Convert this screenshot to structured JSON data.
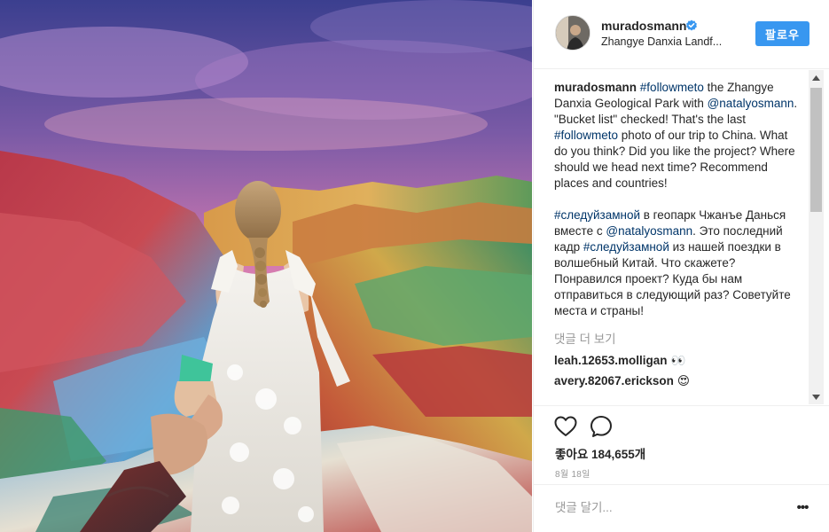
{
  "post": {
    "username": "muradosmann",
    "location": "Zhangye Danxia Landf...",
    "follow_label": "팔로우",
    "caption": {
      "username": "muradosmann",
      "en": [
        {
          "t": "#followmeto",
          "tag": true
        },
        {
          "t": " the Zhangye Danxia Geological Park with ",
          "tag": false
        },
        {
          "t": "@natalyosmann",
          "tag": true
        },
        {
          "t": ". \"Bucket list\" checked! That's the last ",
          "tag": false
        },
        {
          "t": "#followmeto",
          "tag": true
        },
        {
          "t": " photo of our trip to China. What do you think? Did you like the project? Where should we head next time? Recommend places and countries!",
          "tag": false
        }
      ],
      "ru": [
        {
          "t": "#следуйзамной",
          "tag": true
        },
        {
          "t": " в геопарк Чжанъе Данься вместе с ",
          "tag": false
        },
        {
          "t": "@natalyosmann",
          "tag": true
        },
        {
          "t": ". Это последний кадр ",
          "tag": false
        },
        {
          "t": "#следуйзамной",
          "tag": true
        },
        {
          "t": " из нашей поездки в волшебный Китай. Что скажете? Понравился проект? Куда бы нам отправиться в следующий раз? Советуйте места и страны!",
          "tag": false
        }
      ]
    },
    "load_more": "댓글 더 보기",
    "comments": [
      {
        "user": "leah.12653.molligan",
        "emoji": "👀"
      },
      {
        "user": "avery.82067.erickson",
        "emoji": "😍"
      }
    ],
    "likes": "좋아요 184,655개",
    "date": "8월 18일",
    "comment_placeholder": "댓글 달기...",
    "more_label": "•••"
  },
  "icons": {
    "verified": "verified-badge-icon",
    "like": "heart-icon",
    "comment": "comment-bubble-icon"
  },
  "colors": {
    "accent": "#3897f0",
    "hashtag": "#003569",
    "muted": "#999999"
  }
}
